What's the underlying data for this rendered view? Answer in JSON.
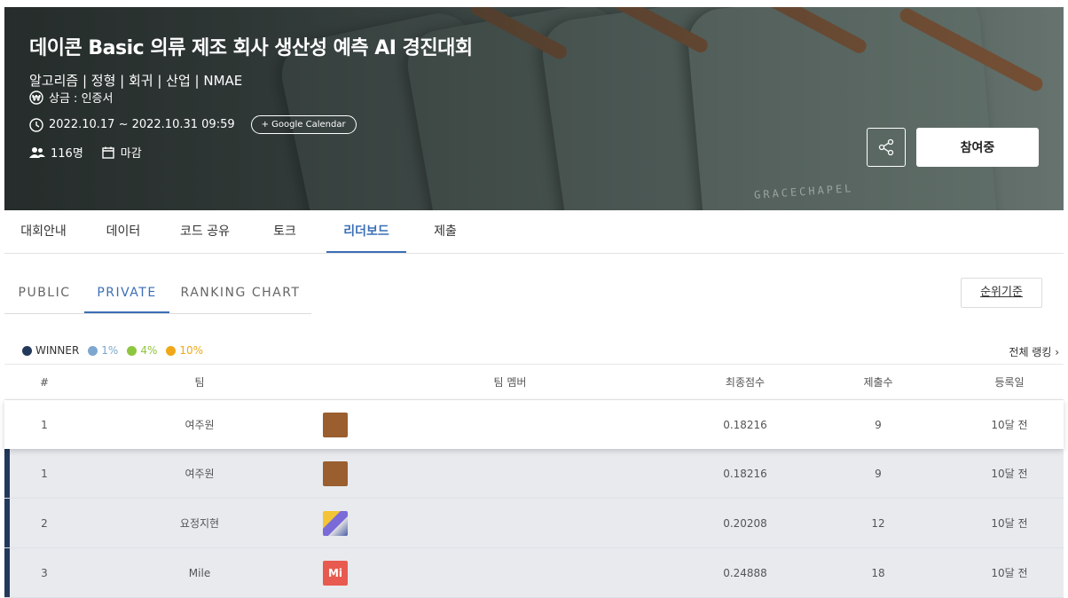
{
  "hero": {
    "title": "데이콘 Basic 의류 제조 회사 생산성 예측 AI 경진대회",
    "tags": "알고리즘 | 정형 | 회귀 | 산업 | NMAE",
    "prize": "상금 : 인증서",
    "period": "2022.10.17 ~ 2022.10.31 09:59",
    "calendar_button": "+ Google Calendar",
    "participants": "116명",
    "status": "마감",
    "brand_text": "GRACECHAPEL",
    "join_button": "참여중"
  },
  "main_tabs": [
    {
      "label": "대회안내"
    },
    {
      "label": "데이터"
    },
    {
      "label": "코드 공유"
    },
    {
      "label": "토크"
    },
    {
      "label": "리더보드",
      "active": true
    },
    {
      "label": "제출"
    }
  ],
  "sub_tabs": [
    {
      "label": "PUBLIC"
    },
    {
      "label": "PRIVATE",
      "active": true
    },
    {
      "label": "RANKING CHART"
    }
  ],
  "rank_basis_button": "순위기준",
  "legend": [
    {
      "label": "WINNER",
      "color": "#23395b"
    },
    {
      "label": "1%",
      "color": "#7ea7cf"
    },
    {
      "label": "4%",
      "color": "#8ec63f"
    },
    {
      "label": "10%",
      "color": "#f0a818"
    }
  ],
  "full_ranking_link": "전체 랭킹 ›",
  "table": {
    "headers": [
      "#",
      "팀",
      "팀 멤버",
      "최종점수",
      "제출수",
      "등록일"
    ],
    "my_row": {
      "rank": "1",
      "team": "여주원",
      "avatar": "brown",
      "score": "0.18216",
      "submissions": "9",
      "date": "10달 전"
    },
    "rows": [
      {
        "rank": "1",
        "team": "여주원",
        "avatar": "brown",
        "score": "0.18216",
        "submissions": "9",
        "date": "10달 전"
      },
      {
        "rank": "2",
        "team": "요정지현",
        "avatar": "pic",
        "score": "0.20208",
        "submissions": "12",
        "date": "10달 전"
      },
      {
        "rank": "3",
        "team": "Mile",
        "avatar": "mi",
        "avatar_text": "Mi",
        "score": "0.24888",
        "submissions": "18",
        "date": "10달 전"
      }
    ]
  }
}
